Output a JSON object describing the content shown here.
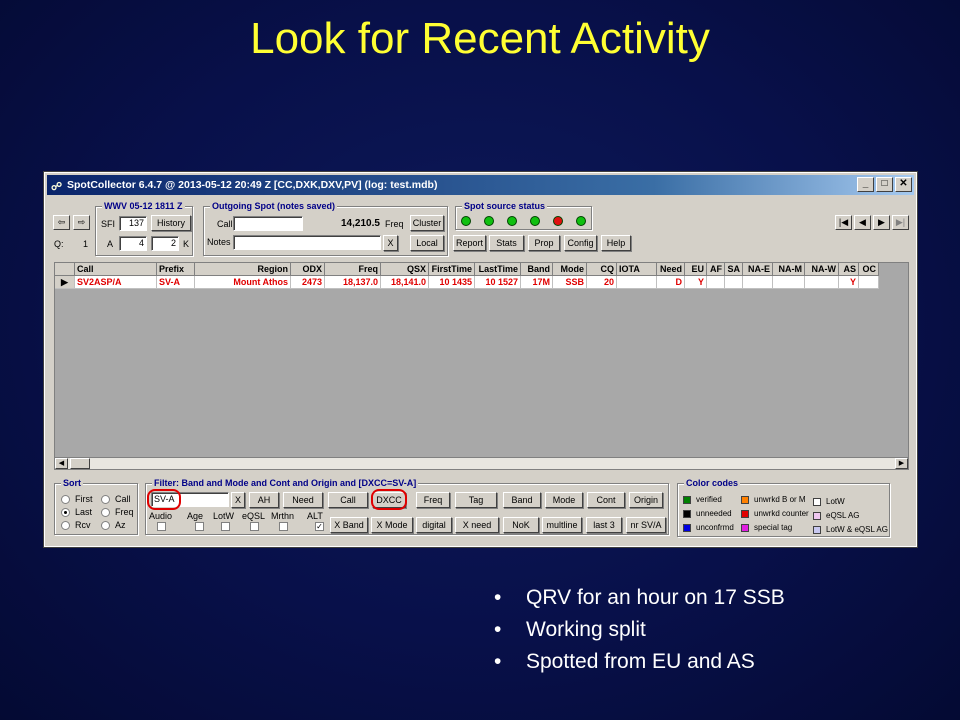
{
  "slide": {
    "title": "Look for Recent Activity",
    "bullets": [
      "QRV for an hour on 17 SSB",
      "Working split",
      "Spotted from EU and AS"
    ]
  },
  "window": {
    "title": "SpotCollector 6.4.7 @ 2013-05-12  20:49 Z [CC,DXK,DXV,PV] (log: test.mdb)",
    "buttons": {
      "minimize": "_",
      "maximize": "□",
      "close": "✕"
    }
  },
  "wwv": {
    "label": "WWV 05-12 1811 Z",
    "sfi_label": "SFI",
    "sfi_value": "137",
    "history_button": "History",
    "q_label": "Q:",
    "q_value": "1",
    "a_label": "A",
    "a_value": "4",
    "k_label": "K",
    "k_value": "2"
  },
  "outgoing": {
    "label": "Outgoing Spot (notes saved)",
    "call_label": "Call",
    "call_value": "",
    "freq_value": "14,210.5",
    "freq_label": "Freq",
    "cluster_button": "Cluster",
    "notes_label": "Notes",
    "notes_value": "",
    "clear_button": "X",
    "local_button": "Local"
  },
  "source": {
    "label": "Spot source status",
    "leds": [
      "#10c010",
      "#10c010",
      "#10c010",
      "#10c010",
      "#e01010",
      "#10c010"
    ],
    "buttons": [
      "Report",
      "Stats",
      "Prop",
      "Config",
      "Help"
    ]
  },
  "grid": {
    "columns": [
      "",
      "Call",
      "Prefix",
      "Region",
      "ODX",
      "Freq",
      "QSX",
      "FirstTime",
      "LastTime",
      "Band",
      "Mode",
      "CQ",
      "IOTA",
      "Need",
      "EU",
      "AF",
      "SA",
      "NA-E",
      "NA-M",
      "NA-W",
      "AS",
      "OC"
    ],
    "row": [
      "▶",
      "SV2ASP/A",
      "SV-A",
      "Mount Athos",
      "2473",
      "18,137.0",
      "18,141.0",
      "10 1435",
      "10 1527",
      "17M",
      "SSB",
      "20",
      "",
      "D",
      "Y",
      "",
      "",
      "",
      "",
      "",
      "Y",
      ""
    ]
  },
  "sort": {
    "label": "Sort",
    "options": [
      "First",
      "Call",
      "Last",
      "Freq",
      "Rcv",
      "Az"
    ],
    "selected": "Last"
  },
  "filter": {
    "label": "Filter: Band and Mode and Cont and Origin and [DXCC=SV-A]",
    "input_value": "SV-A",
    "clear_button": "X",
    "row1": [
      "AH",
      "Need",
      "Call",
      "DXCC",
      "Freq",
      "Tag",
      "Band",
      "Mode",
      "Cont",
      "Origin"
    ],
    "checks": [
      "Audio",
      "Age",
      "LotW",
      "eQSL",
      "Mrthn",
      "ALT"
    ],
    "row2": [
      "X Band",
      "X Mode",
      "digital",
      "X need",
      "NoK",
      "multline",
      "last 3",
      "nr SV/A"
    ]
  },
  "colors": {
    "label": "Color codes",
    "items": [
      {
        "text": "verified",
        "color": "#008000"
      },
      {
        "text": "unneeded",
        "color": "#000000"
      },
      {
        "text": "unconfrmd",
        "color": "#0000e0"
      },
      {
        "text": "unwrkd B or M",
        "color": "#ff8000"
      },
      {
        "text": "unwrkd counter",
        "color": "#e00000"
      },
      {
        "text": "special tag",
        "color": "#e020e0"
      },
      {
        "text": "LotW",
        "color": "#ffffff"
      },
      {
        "text": "eQSL AG",
        "color": "#f0c8f0"
      },
      {
        "text": "LotW & eQSL AG",
        "color": "#c8c8f0"
      }
    ]
  }
}
